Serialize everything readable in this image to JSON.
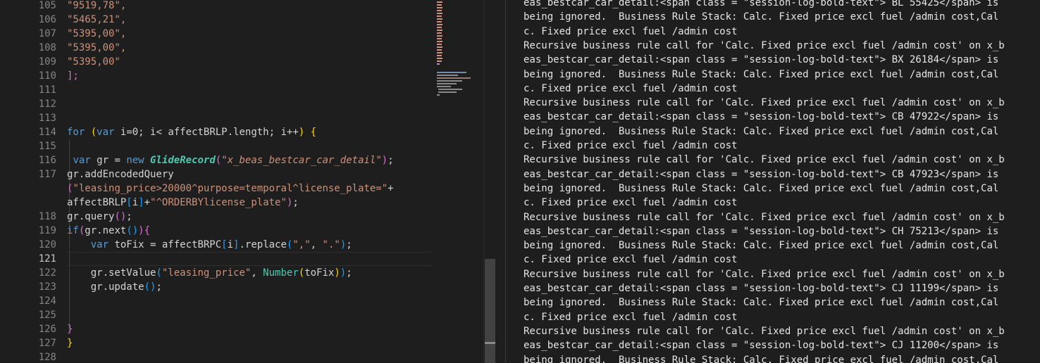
{
  "editor": {
    "line_numbers": [
      "105",
      "106",
      "107",
      "108",
      "109",
      "110",
      "111",
      "112",
      "113",
      "114",
      "115",
      "116",
      "117",
      "",
      "",
      "118",
      "119",
      "120",
      "121",
      "122",
      "123",
      "124",
      "125",
      "126",
      "127",
      "128"
    ],
    "active_line": "121",
    "lines": {
      "l105": "\"9519,78\",",
      "l106": "\"5465,21\",",
      "l107": "\"5395,00\",",
      "l108": "\"5395,00\",",
      "l109": "\"5395,00\"",
      "l110": "];",
      "l114_for": "for",
      "l114_open": "(",
      "l114_var": "var",
      "l114_rest": " i=0; i< affectBRLP.length; i++",
      "l114_close": ")",
      "l114_brace": "{",
      "l116_var": "var",
      "l116_gr": " gr = ",
      "l116_new": "new",
      "l116_cls": "GlideRecord",
      "l116_open": "(",
      "l116_str": "\"x_beas_bestcar_car_detail\"",
      "l116_close": ")",
      "l116_semi": ";",
      "l117a": "gr.addEncodedQuery",
      "l117b_open": "(",
      "l117b_str": "\"leasing_price>20000^purpose=temporal^license_plate=\"",
      "l117b_plus": "+",
      "l117c_a": "affectBRLP",
      "l117c_ob": "[",
      "l117c_i": "i",
      "l117c_cb": "]",
      "l117c_plus": "+",
      "l117c_str": "\"^ORDERBYlicense_plate\"",
      "l117c_close": ")",
      "l117c_semi": ";",
      "l118_a": "gr.query",
      "l118_p": "()",
      "l118_semi": ";",
      "l119_if": "if",
      "l119_open": "(",
      "l119_mid": "gr.next",
      "l119_p": "()",
      "l119_close": ")",
      "l119_brace": "{",
      "l120_var": "var",
      "l120_mid": " toFix = affectBRPC",
      "l120_ob": "[",
      "l120_i": "i",
      "l120_cb": "]",
      "l120_rep": ".replace",
      "l120_open": "(",
      "l120_s1": "\",\"",
      "l120_comma": ", ",
      "l120_s2": "\".\"",
      "l120_close": ")",
      "l120_semi": ";",
      "l122_a": "gr.setValue",
      "l122_open": "(",
      "l122_str": "\"leasing_price\"",
      "l122_comma": ", ",
      "l122_num": "Number",
      "l122_open2": "(",
      "l122_arg": "toFix",
      "l122_close2": ")",
      "l122_close": ")",
      "l122_semi": ";",
      "l123_a": "gr.update",
      "l123_p": "()",
      "l123_semi": ";",
      "l126": "}",
      "l127": "}"
    }
  },
  "log": {
    "lines": [
      "eas_bestcar_car_detail:<span class = \"session-log-bold-text\"> BL 55425</span> is",
      "being ignored.  Business Rule Stack: Calc. Fixed price excl fuel /admin cost,Cal",
      "c. Fixed price excl fuel /admin cost",
      "Recursive business rule call for 'Calc. Fixed price excl fuel /admin cost' on x_b",
      "eas_bestcar_car_detail:<span class = \"session-log-bold-text\"> BX 26184</span> is",
      "being ignored.  Business Rule Stack: Calc. Fixed price excl fuel /admin cost,Cal",
      "c. Fixed price excl fuel /admin cost",
      "Recursive business rule call for 'Calc. Fixed price excl fuel /admin cost' on x_b",
      "eas_bestcar_car_detail:<span class = \"session-log-bold-text\"> CB 47922</span> is",
      "being ignored.  Business Rule Stack: Calc. Fixed price excl fuel /admin cost,Cal",
      "c. Fixed price excl fuel /admin cost",
      "Recursive business rule call for 'Calc. Fixed price excl fuel /admin cost' on x_b",
      "eas_bestcar_car_detail:<span class = \"session-log-bold-text\"> CB 47923</span> is",
      "being ignored.  Business Rule Stack: Calc. Fixed price excl fuel /admin cost,Cal",
      "c. Fixed price excl fuel /admin cost",
      "Recursive business rule call for 'Calc. Fixed price excl fuel /admin cost' on x_b",
      "eas_bestcar_car_detail:<span class = \"session-log-bold-text\"> CH 75213</span> is",
      "being ignored.  Business Rule Stack: Calc. Fixed price excl fuel /admin cost,Cal",
      "c. Fixed price excl fuel /admin cost",
      "Recursive business rule call for 'Calc. Fixed price excl fuel /admin cost' on x_b",
      "eas_bestcar_car_detail:<span class = \"session-log-bold-text\"> CJ 11199</span> is",
      "being ignored.  Business Rule Stack: Calc. Fixed price excl fuel /admin cost,Cal",
      "c. Fixed price excl fuel /admin cost",
      "Recursive business rule call for 'Calc. Fixed price excl fuel /admin cost' on x_b",
      "eas_bestcar_car_detail:<span class = \"session-log-bold-text\"> CJ 11200</span> is",
      "being ignored.  Business Rule Stack: Calc. Fixed price excl fuel /admin cost,Cal"
    ]
  }
}
